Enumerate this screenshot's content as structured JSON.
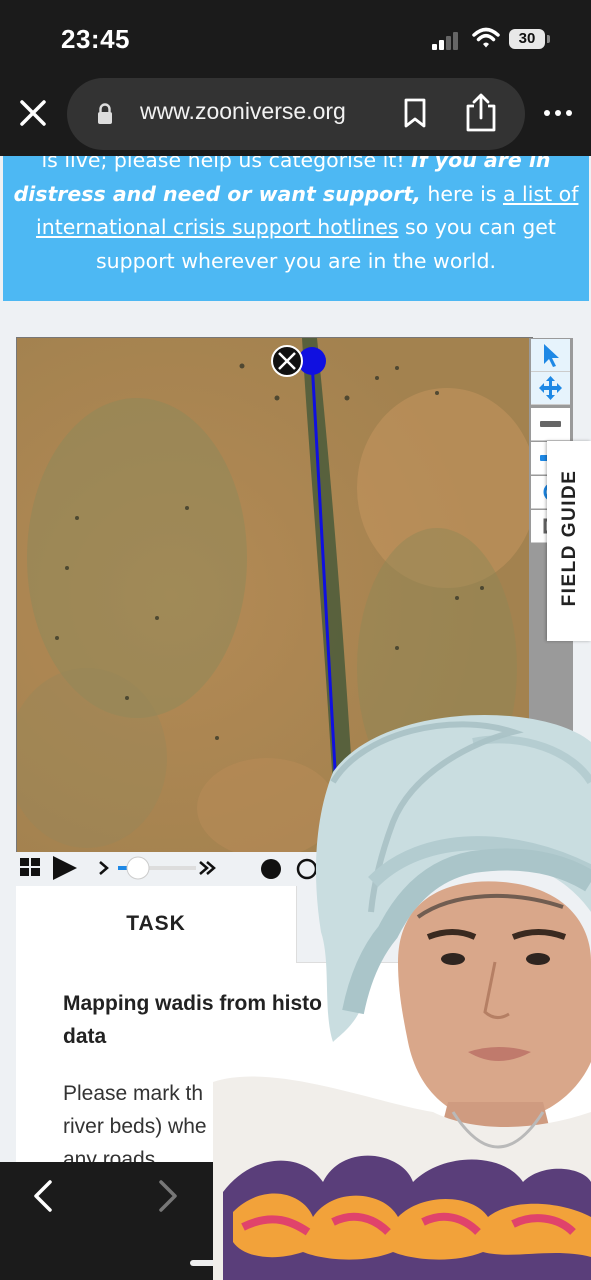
{
  "status_bar": {
    "time": "23:45",
    "battery": "30"
  },
  "browser": {
    "url": "www.zooniverse.org"
  },
  "banner": {
    "line1_a": "is live; please help us categorise it! ",
    "line1_b": "If you are in",
    "line2_a": "distress and need or want support,",
    "line2_b": " here is ",
    "line2_c": "a list of",
    "line3_a": "international crisis support hotlines",
    "line3_b": " so you can get",
    "line4": "support wherever you are in the world."
  },
  "field_guide": "FIELD GUIDE",
  "task_panel": {
    "tab": "TASK",
    "title": "Mapping wadis from histo\ndata",
    "body_line1": "Please mark th",
    "body_line2": "river beds) whe",
    "body_line3": "any roads."
  },
  "colors": {
    "banner": "#4db8f3",
    "accent": "#1e88e5",
    "line": "#1010e0"
  }
}
